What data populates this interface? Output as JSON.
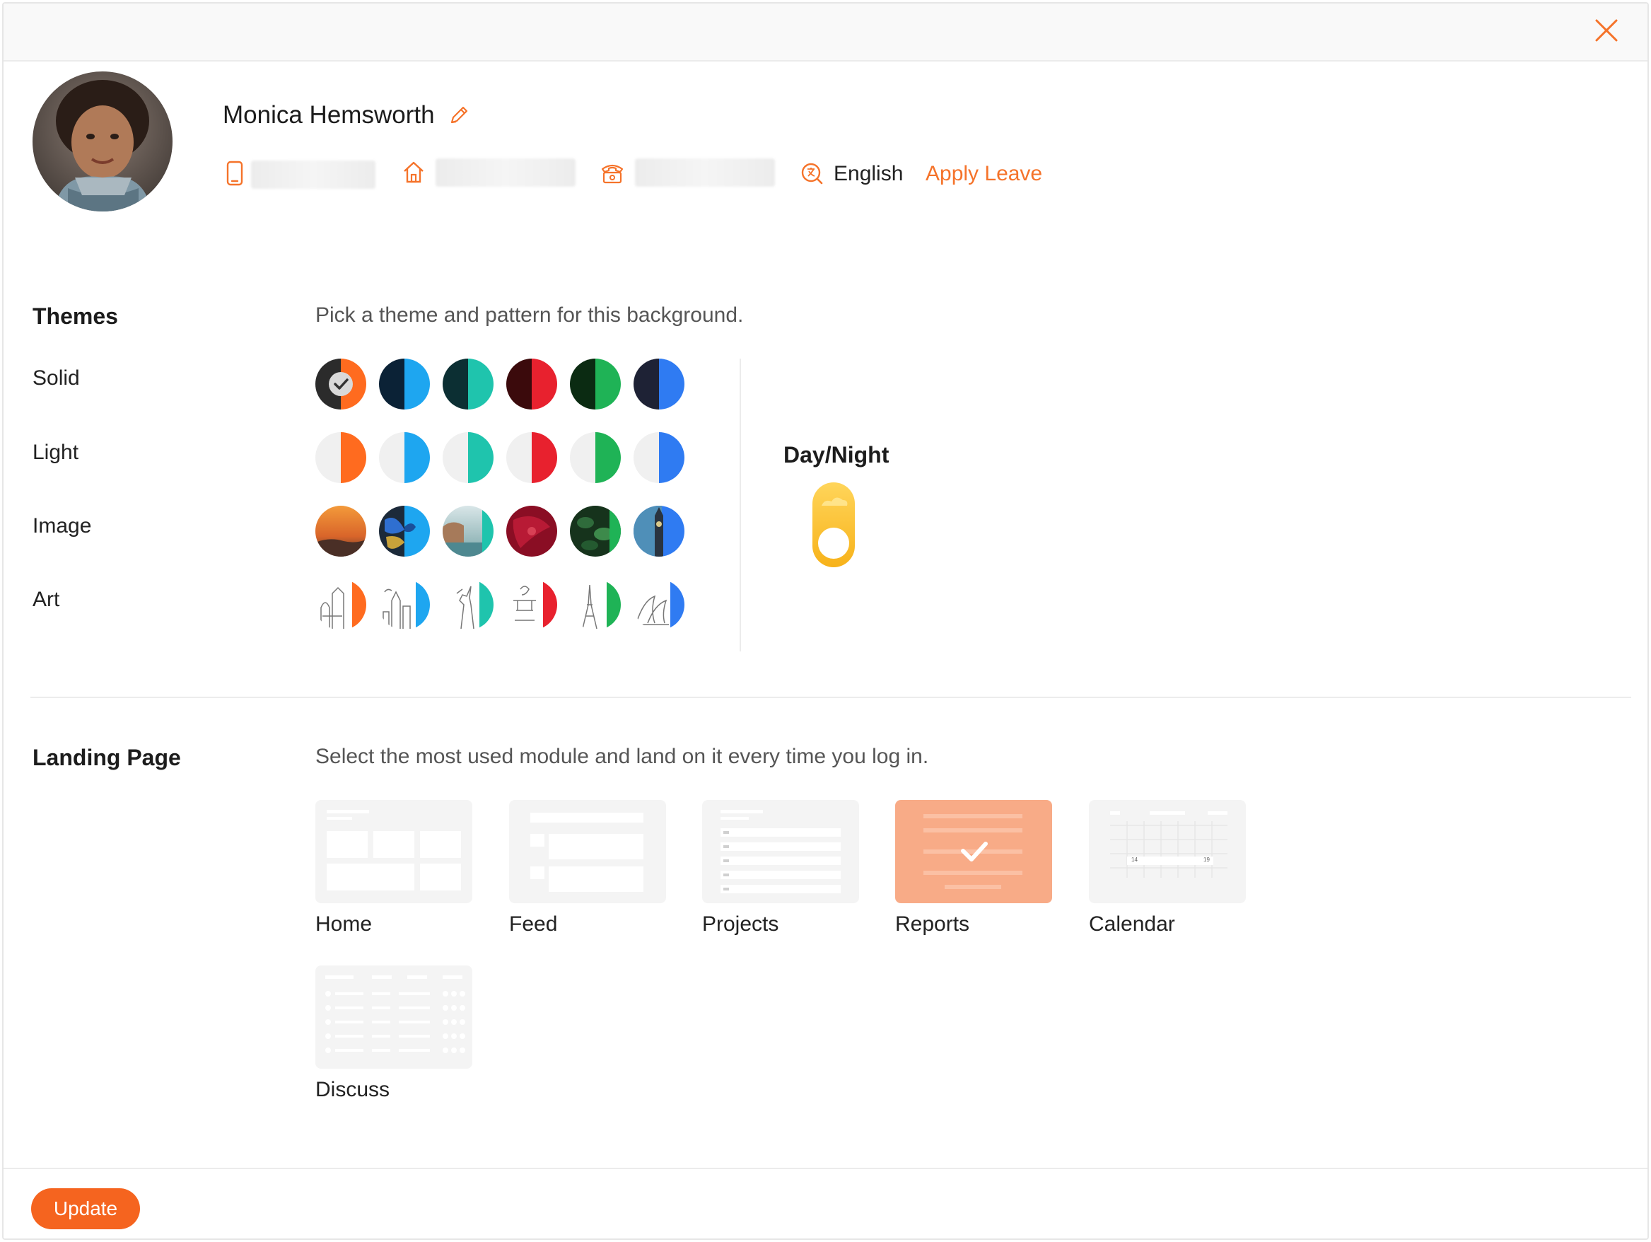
{
  "header": {
    "close_icon": "close-icon"
  },
  "profile": {
    "name": "Monica Hemsworth",
    "language": "English",
    "apply_leave": "Apply Leave",
    "accent_color": "#f5732a"
  },
  "themes": {
    "title": "Themes",
    "description": "Pick a theme and pattern for this background.",
    "rows": [
      "Solid",
      "Light",
      "Image",
      "Art"
    ],
    "colors": [
      "#ff6b1f",
      "#1ea6f0",
      "#1fc4ad",
      "#e8212e",
      "#1fb356",
      "#2f7bf2"
    ],
    "solid_dark": [
      "#2b2b2b",
      "#0b2236",
      "#0c2f33",
      "#3b0a0c",
      "#0b2b12",
      "#1e2235"
    ],
    "selected": "Solid-0"
  },
  "daynight": {
    "label": "Day/Night",
    "state": "day"
  },
  "landing": {
    "title": "Landing Page",
    "description": "Select the most used module and land on it every time you log in.",
    "modules": [
      "Home",
      "Feed",
      "Projects",
      "Reports",
      "Calendar",
      "Discuss"
    ],
    "selected": "Reports",
    "calendar_numbers": [
      "14",
      "19"
    ]
  },
  "footer": {
    "update_label": "Update"
  }
}
